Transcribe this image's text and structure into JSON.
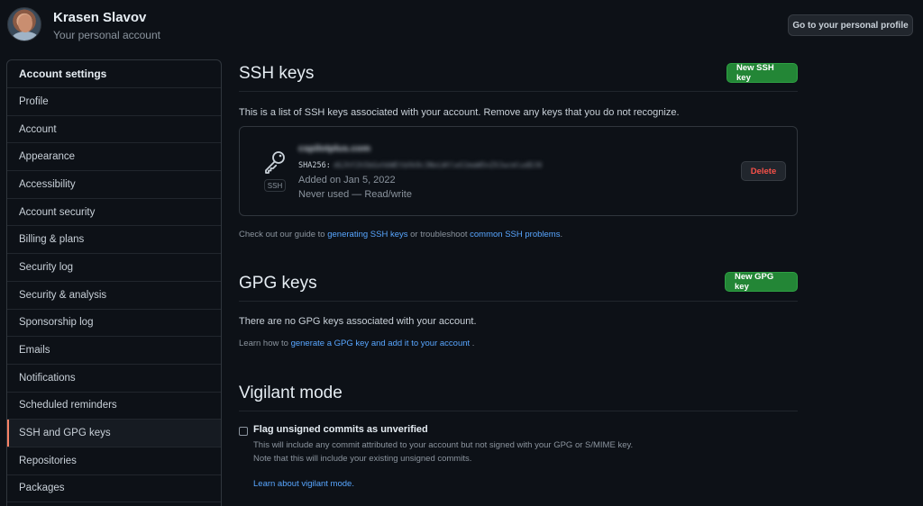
{
  "header": {
    "user_name": "Krasen Slavov",
    "user_subtitle": "Your personal account",
    "profile_button": "Go to your personal profile"
  },
  "sidebar": {
    "heading": "Account settings",
    "items": [
      {
        "label": "Profile"
      },
      {
        "label": "Account"
      },
      {
        "label": "Appearance"
      },
      {
        "label": "Accessibility"
      },
      {
        "label": "Account security"
      },
      {
        "label": "Billing & plans"
      },
      {
        "label": "Security log"
      },
      {
        "label": "Security & analysis"
      },
      {
        "label": "Sponsorship log"
      },
      {
        "label": "Emails"
      },
      {
        "label": "Notifications"
      },
      {
        "label": "Scheduled reminders"
      },
      {
        "label": "SSH and GPG keys",
        "active": true
      },
      {
        "label": "Repositories"
      },
      {
        "label": "Packages"
      }
    ]
  },
  "ssh": {
    "title": "SSH keys",
    "new_button": "New SSH key",
    "description": "This is a list of SSH keys associated with your account. Remove any keys that you do not recognize.",
    "key": {
      "title": "cspilotplus.com",
      "fingerprint_label": "SHA256:",
      "fingerprint_value": "dGJhY2h5bGxhbWEtbXk9c3NoLWtleS1maW5nZXJwcmludDJ0",
      "added": "Added on Jan 5, 2022",
      "usage": "Never used — Read/write",
      "badge": "SSH",
      "delete_button": "Delete"
    },
    "guide_prefix": "Check out our guide to ",
    "guide_link1": "generating SSH keys",
    "guide_middle": " or troubleshoot ",
    "guide_link2": "common SSH problems",
    "guide_suffix": "."
  },
  "gpg": {
    "title": "GPG keys",
    "new_button": "New GPG key",
    "empty_text": "There are no GPG keys associated with your account.",
    "learn_prefix": "Learn how to ",
    "learn_link": "generate a GPG key and add it to your account",
    "learn_suffix": " ."
  },
  "vigilant": {
    "title": "Vigilant mode",
    "checkbox_label": "Flag unsigned commits as unverified",
    "desc_line1": "This will include any commit attributed to your account but not signed with your GPG or S/MIME key.",
    "desc_line2": "Note that this will include your existing unsigned commits.",
    "learn_link": "Learn about vigilant mode."
  },
  "colors": {
    "background": "#0d1117",
    "accent_green": "#238636",
    "link_blue": "#58a6ff",
    "danger_red": "#f85149",
    "active_marker": "#f78166"
  }
}
